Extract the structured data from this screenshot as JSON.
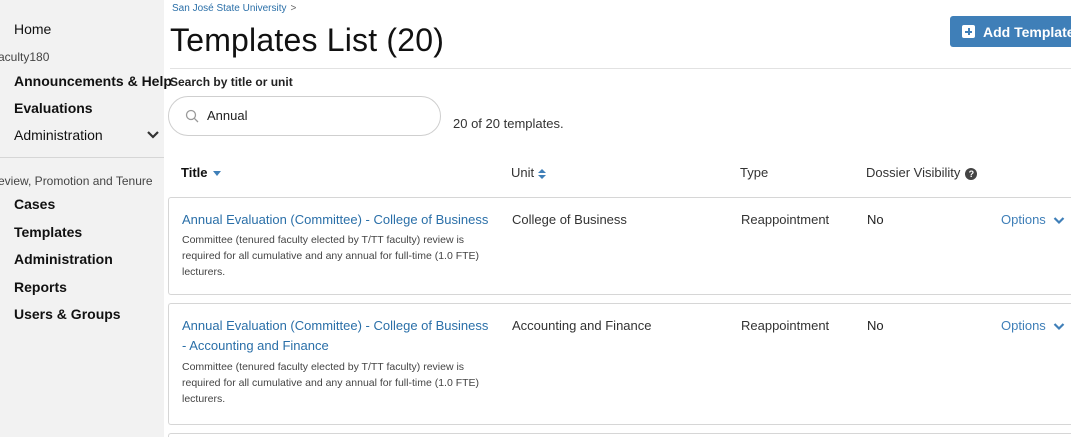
{
  "sidebar": {
    "home": "Home",
    "section1": "aculty180",
    "announcements": "Announcements & Help",
    "evaluations": "Evaluations",
    "administration": "Administration",
    "section2": "eview, Promotion and Tenure",
    "cases": "Cases",
    "templates": "Templates",
    "administration2": "Administration",
    "reports": "Reports",
    "users_groups": "Users & Groups"
  },
  "breadcrumb": {
    "university": "San José State University",
    "separator": ">"
  },
  "page": {
    "title": "Templates List (20)",
    "add_button": "Add Template"
  },
  "search": {
    "label": "Search by title or unit",
    "value": "Annual",
    "count_text": "20 of 20 templates."
  },
  "table": {
    "headers": {
      "title": "Title",
      "unit": "Unit",
      "type": "Type",
      "visibility": "Dossier Visibility"
    },
    "rows": [
      {
        "title": "Annual Evaluation (Committee) - College of Business",
        "description": "Committee (tenured faculty elected by T/TT faculty) review is required for all cumulative and any annual for full-time (1.0 FTE) lecturers.",
        "unit": "College of Business",
        "type": "Reappointment",
        "visibility": "No",
        "options": "Options"
      },
      {
        "title": "Annual Evaluation (Committee) - College of Business - Accounting and Finance",
        "description": "Committee (tenured faculty elected by T/TT faculty) review is required for all cumulative and any annual for full-time (1.0 FTE) lecturers.",
        "unit": "Accounting and Finance",
        "type": "Reappointment",
        "visibility": "No",
        "options": "Options"
      }
    ]
  },
  "colors": {
    "link": "#2a6fa8",
    "accent": "#3f7fb8",
    "sidebar_bg": "#f2f2f2"
  },
  "icons": [
    "chevron-down-icon",
    "plus-square-icon",
    "search-icon",
    "sort-desc-icon",
    "sort-icon",
    "help-circle-icon"
  ]
}
